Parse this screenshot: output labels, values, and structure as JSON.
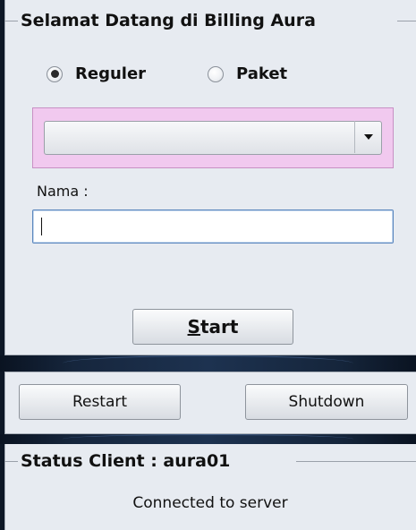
{
  "login": {
    "title": "Selamat Datang di Billing Aura",
    "radio_options": [
      {
        "label": "Reguler",
        "selected": true
      },
      {
        "label": "Paket",
        "selected": false
      }
    ],
    "package_select": {
      "value": ""
    },
    "name_label": "Nama :",
    "name_value": "",
    "start_label_mnemonic": "S",
    "start_label_rest": "tart"
  },
  "power": {
    "restart_label": "Restart",
    "shutdown_label": "Shutdown"
  },
  "status": {
    "title": "Status Client : aura01",
    "message": "Connected to server"
  },
  "colors": {
    "combo_highlight": "#f1c9ef",
    "panel_bg": "#e7ebf1",
    "background": "#0d1726"
  }
}
